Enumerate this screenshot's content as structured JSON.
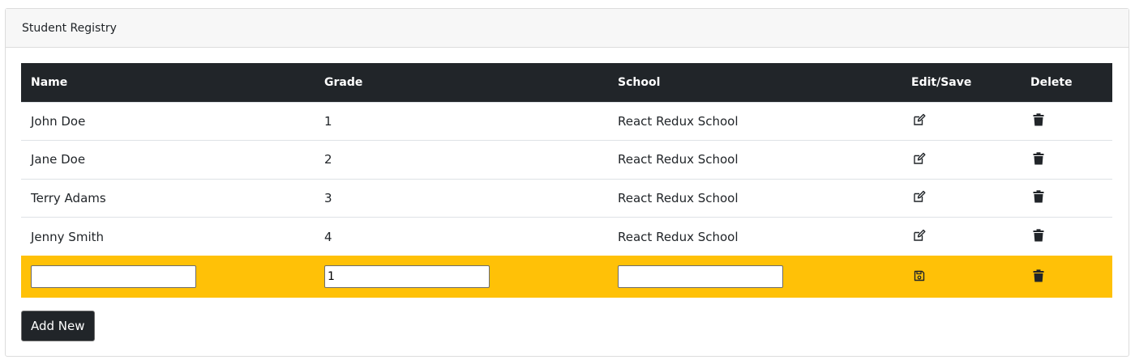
{
  "panel": {
    "title": "Student Registry"
  },
  "table": {
    "headers": {
      "name": "Name",
      "grade": "Grade",
      "school": "School",
      "edit": "Edit/Save",
      "delete": "Delete"
    },
    "rows": [
      {
        "name": "John Doe",
        "grade": "1",
        "school": "React Redux School"
      },
      {
        "name": "Jane Doe",
        "grade": "2",
        "school": "React Redux School"
      },
      {
        "name": "Terry Adams",
        "grade": "3",
        "school": "React Redux School"
      },
      {
        "name": "Jenny Smith",
        "grade": "4",
        "school": "React Redux School"
      }
    ],
    "edit_row": {
      "name_value": "",
      "grade_value": "1",
      "school_value": ""
    }
  },
  "icons": {
    "edit": "edit-icon",
    "delete": "trash-icon",
    "save": "save-icon"
  },
  "actions": {
    "add_new_label": "Add New"
  },
  "colors": {
    "header_bg": "#212529",
    "edit_row_bg": "#ffc107",
    "button_bg": "#212529"
  }
}
